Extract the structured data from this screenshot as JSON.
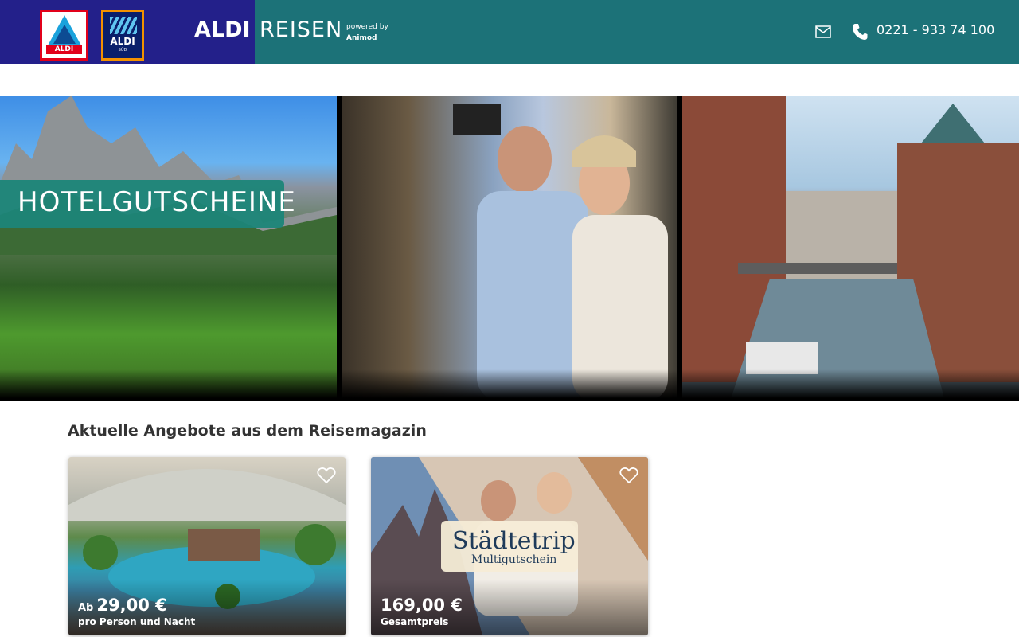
{
  "header": {
    "logo_nord_label": "ALDI",
    "logo_sued_label": "ALDI",
    "logo_sued_sub": "SÜD",
    "brand_primary": "ALDI",
    "brand_secondary": "REISEN",
    "powered_by": "powered by",
    "powered_company": "Animod",
    "phone": "0221 - 933 74 100",
    "colors": {
      "bar": "#1c7278",
      "logo_panel": "#23208a"
    }
  },
  "hero": {
    "panels": [
      {
        "icon": "mountain-landscape-image",
        "badge": "HOTELGUTSCHEINE"
      },
      {
        "icon": "couple-selfie-image"
      },
      {
        "icon": "city-canal-image"
      }
    ]
  },
  "section": {
    "title": "Aktuelle Angebote aus dem Reisemagazin"
  },
  "offers": [
    {
      "prefix": "Ab",
      "price": "29,00 €",
      "note": "pro Person und Nacht",
      "image": "tropical-dome-pool-image"
    },
    {
      "prefix": "",
      "price": "169,00 €",
      "note": "Gesamtpreis",
      "image": "city-trip-collage-image",
      "overlay_title": "Städtetrip",
      "overlay_sub": "Multigutschein"
    }
  ]
}
